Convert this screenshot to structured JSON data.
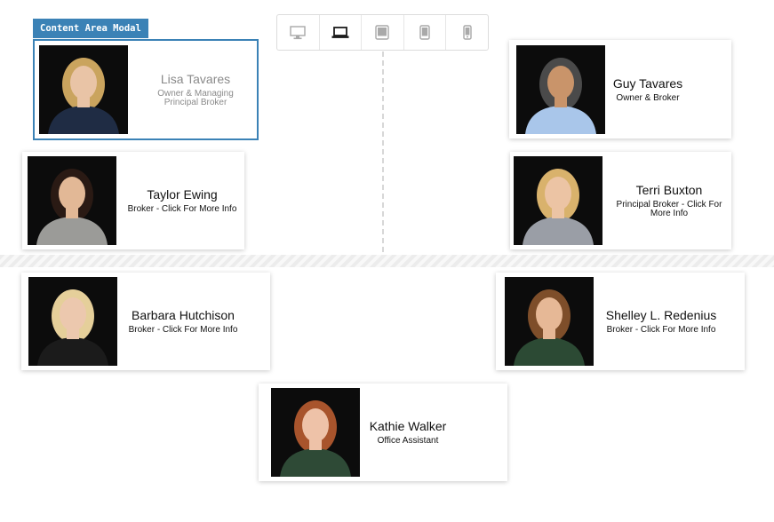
{
  "editor": {
    "modal_label": "Content Area Modal",
    "device_buttons": [
      {
        "icon": "desktop-icon",
        "active": false
      },
      {
        "icon": "laptop-icon",
        "active": true
      },
      {
        "icon": "tablet-landscape-icon",
        "active": false
      },
      {
        "icon": "tablet-portrait-icon",
        "active": false
      },
      {
        "icon": "mobile-icon",
        "active": false
      }
    ],
    "accent_color": "#3b82b6"
  },
  "team": [
    {
      "name": "Lisa Tavares",
      "role": "Owner & Managing Principal Broker",
      "hair": "#caa45e",
      "top": "#1f2c44",
      "skin": "#e9c4a6"
    },
    {
      "name": "Guy Tavares",
      "role": "Owner & Broker",
      "hair": "#4a4a4a",
      "top": "#a9c6ea",
      "skin": "#c9946a"
    },
    {
      "name": "Taylor Ewing",
      "role": "Broker - Click For More Info",
      "hair": "#2a1a14",
      "top": "#9b9b98",
      "skin": "#e2b896"
    },
    {
      "name": "Terri Buxton",
      "role": "Principal Broker - Click For More Info",
      "hair": "#d9b26c",
      "top": "#9a9ea6",
      "skin": "#ecc4a4"
    },
    {
      "name": "Barbara Hutchison",
      "role": "Broker - Click For More Info",
      "hair": "#e5cf9a",
      "top": "#1b1b1b",
      "skin": "#ecc8ae"
    },
    {
      "name": "Shelley L. Redenius",
      "role": "Broker - Click For More Info",
      "hair": "#7e4e2a",
      "top": "#2c4a34",
      "skin": "#e6b896"
    },
    {
      "name": "Kathie Walker",
      "role": "Office Assistant",
      "hair": "#a8542c",
      "top": "#2e4a36",
      "skin": "#eec2a8"
    }
  ]
}
